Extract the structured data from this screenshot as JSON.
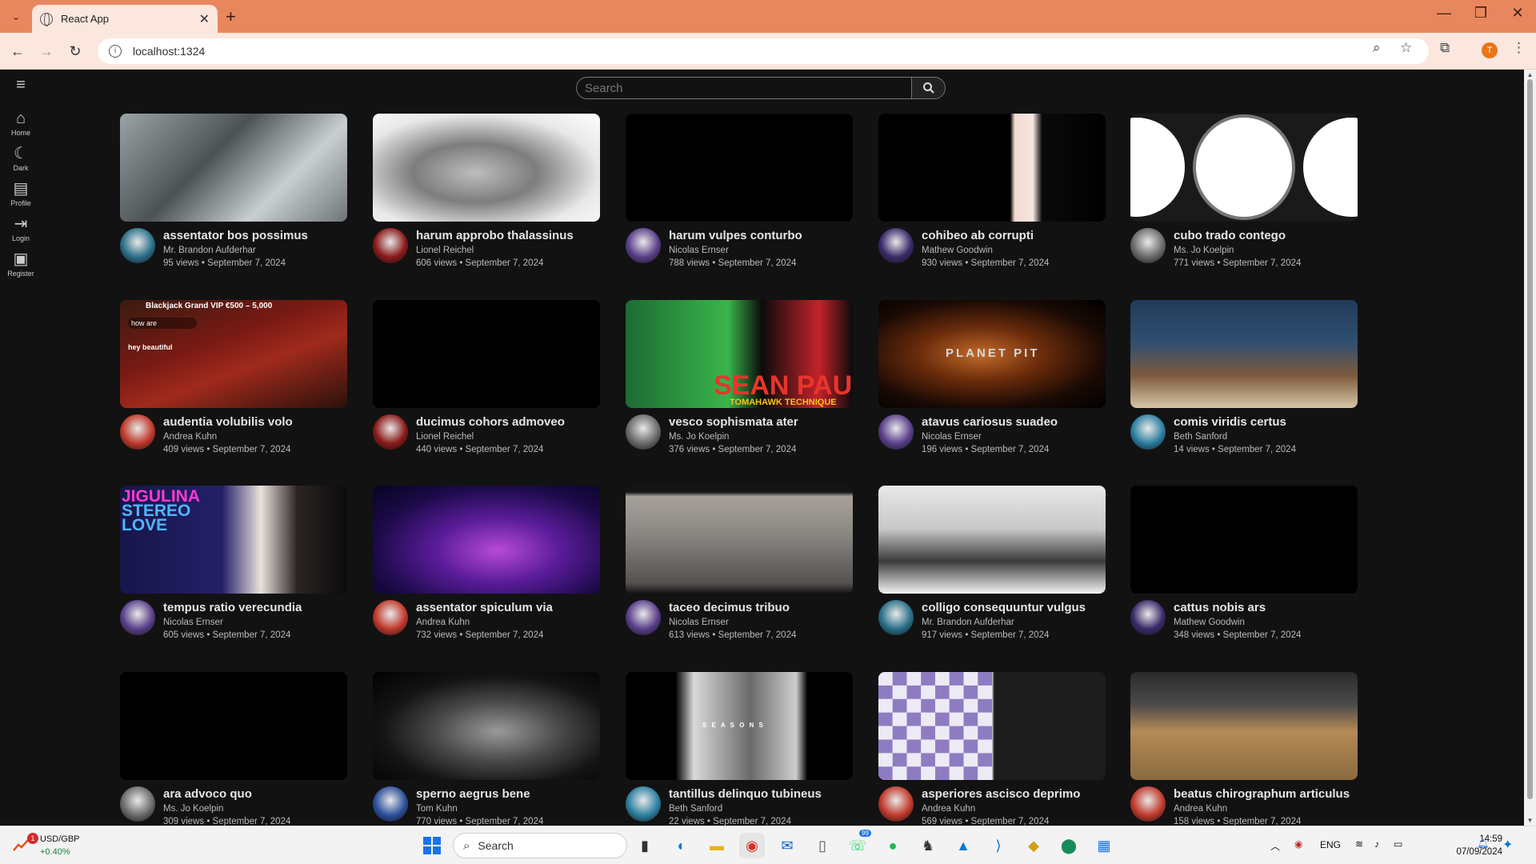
{
  "browser": {
    "tab_title": "React App",
    "url": "localhost:1324",
    "new_tab_symbol": "+",
    "profile_initial": "T"
  },
  "sidebar": {
    "items": [
      {
        "label": "Home",
        "icon": "home-icon"
      },
      {
        "label": "Dark",
        "icon": "moon-icon"
      },
      {
        "label": "Profile",
        "icon": "profile-icon"
      },
      {
        "label": "Login",
        "icon": "login-icon"
      },
      {
        "label": "Register",
        "icon": "register-icon"
      }
    ]
  },
  "search": {
    "placeholder": "Search"
  },
  "videos": [
    {
      "title": "assentator bos possimus",
      "author": "Mr. Brandon Aufderhar",
      "stats": "95 views • September 7, 2024",
      "thumb": "office",
      "avatar": "#2a6f8a"
    },
    {
      "title": "harum approbo thalassinus",
      "author": "Lionel Reichel",
      "stats": "606 views • September 7, 2024",
      "thumb": "face",
      "avatar": "#8b1a1a"
    },
    {
      "title": "harum vulpes conturbo",
      "author": "Nicolas Ernser",
      "stats": "788 views • September 7, 2024",
      "thumb": "black",
      "avatar": "#5a3f8a"
    },
    {
      "title": "cohibeo ab corrupti",
      "author": "Mathew Goodwin",
      "stats": "930 views • September 7, 2024",
      "thumb": "door",
      "avatar": "#3a2a6a"
    },
    {
      "title": "cubo trado contego",
      "author": "Ms. Jo Koelpin",
      "stats": "771 views • September 7, 2024",
      "thumb": "rings",
      "avatar": "#6a6a6a"
    },
    {
      "title": "audentia volubilis volo",
      "author": "Andrea Kuhn",
      "stats": "409 views • September 7, 2024",
      "thumb": "casino",
      "avatar": "#c0392b"
    },
    {
      "title": "ducimus cohors admoveo",
      "author": "Lionel Reichel",
      "stats": "440 views • September 7, 2024",
      "thumb": "black",
      "avatar": "#8b1a1a"
    },
    {
      "title": "vesco sophismata ater",
      "author": "Ms. Jo Koelpin",
      "stats": "376 views • September 7, 2024",
      "thumb": "seanpaul",
      "avatar": "#6a6a6a"
    },
    {
      "title": "atavus cariosus suadeo",
      "author": "Nicolas Ernser",
      "stats": "196 views • September 7, 2024",
      "thumb": "planet",
      "avatar": "#5a3f8a"
    },
    {
      "title": "comis viridis certus",
      "author": "Beth Sanford",
      "stats": "14 views • September 7, 2024",
      "thumb": "chess1",
      "avatar": "#2c7fa0"
    },
    {
      "title": "tempus ratio verecundia",
      "author": "Nicolas Ernser",
      "stats": "605 views • September 7, 2024",
      "thumb": "stereo",
      "avatar": "#5a3f8a"
    },
    {
      "title": "assentator spiculum via",
      "author": "Andrea Kuhn",
      "stats": "732 views • September 7, 2024",
      "thumb": "xfactor",
      "avatar": "#c0392b"
    },
    {
      "title": "taceo decimus tribuo",
      "author": "Nicolas Ernser",
      "stats": "613 views • September 7, 2024",
      "thumb": "sea",
      "avatar": "#5a3f8a"
    },
    {
      "title": "colligo consequuntur vulgus",
      "author": "Mr. Brandon Aufderhar",
      "stats": "917 views • September 7, 2024",
      "thumb": "chess2",
      "avatar": "#2a6f8a"
    },
    {
      "title": "cattus nobis ars",
      "author": "Mathew Goodwin",
      "stats": "348 views • September 7, 2024",
      "thumb": "black",
      "avatar": "#3a2a6a"
    },
    {
      "title": "ara advoco quo",
      "author": "Ms. Jo Koelpin",
      "stats": "309 views • September 7, 2024",
      "thumb": "black",
      "avatar": "#6a6a6a"
    },
    {
      "title": "sperno aegrus bene",
      "author": "Tom Kuhn",
      "stats": "770 views • September 7, 2024",
      "thumb": "chair",
      "avatar": "#2a4f9a"
    },
    {
      "title": "tantillus delinquo tubineus",
      "author": "Beth Sanford",
      "stats": "22 views • September 7, 2024",
      "thumb": "bw",
      "avatar": "#2c7fa0"
    },
    {
      "title": "asperiores ascisco deprimo",
      "author": "Andrea Kuhn",
      "stats": "569 views • September 7, 2024",
      "thumb": "stream",
      "avatar": "#c0392b"
    },
    {
      "title": "beatus chirographum articulus",
      "author": "Andrea Kuhn",
      "stats": "158 views • September 7, 2024",
      "thumb": "bball",
      "avatar": "#c0392b"
    }
  ],
  "thumb_text": {
    "casino_top": "Blackjack Grand VIP €500 – 5,000",
    "casino_input": "how are",
    "casino_msg": "hey beautiful",
    "stereo": [
      "JIGULINA",
      "STEREO",
      "LOVE"
    ],
    "seanpaul": "SEAN PAUL",
    "seanpaul_sub": "TOMAHAWK TECHNIQUE",
    "planet": "PLANET PIT",
    "bw": "S E A S O N S"
  },
  "taskbar": {
    "ticker_pair": "USD/GBP",
    "ticker_change": "+0.40%",
    "ticker_badge": "1",
    "search_label": "Search",
    "whatsapp_badge": "99",
    "lang": "ENG",
    "time": "14:59",
    "date": "07/09/2024"
  }
}
